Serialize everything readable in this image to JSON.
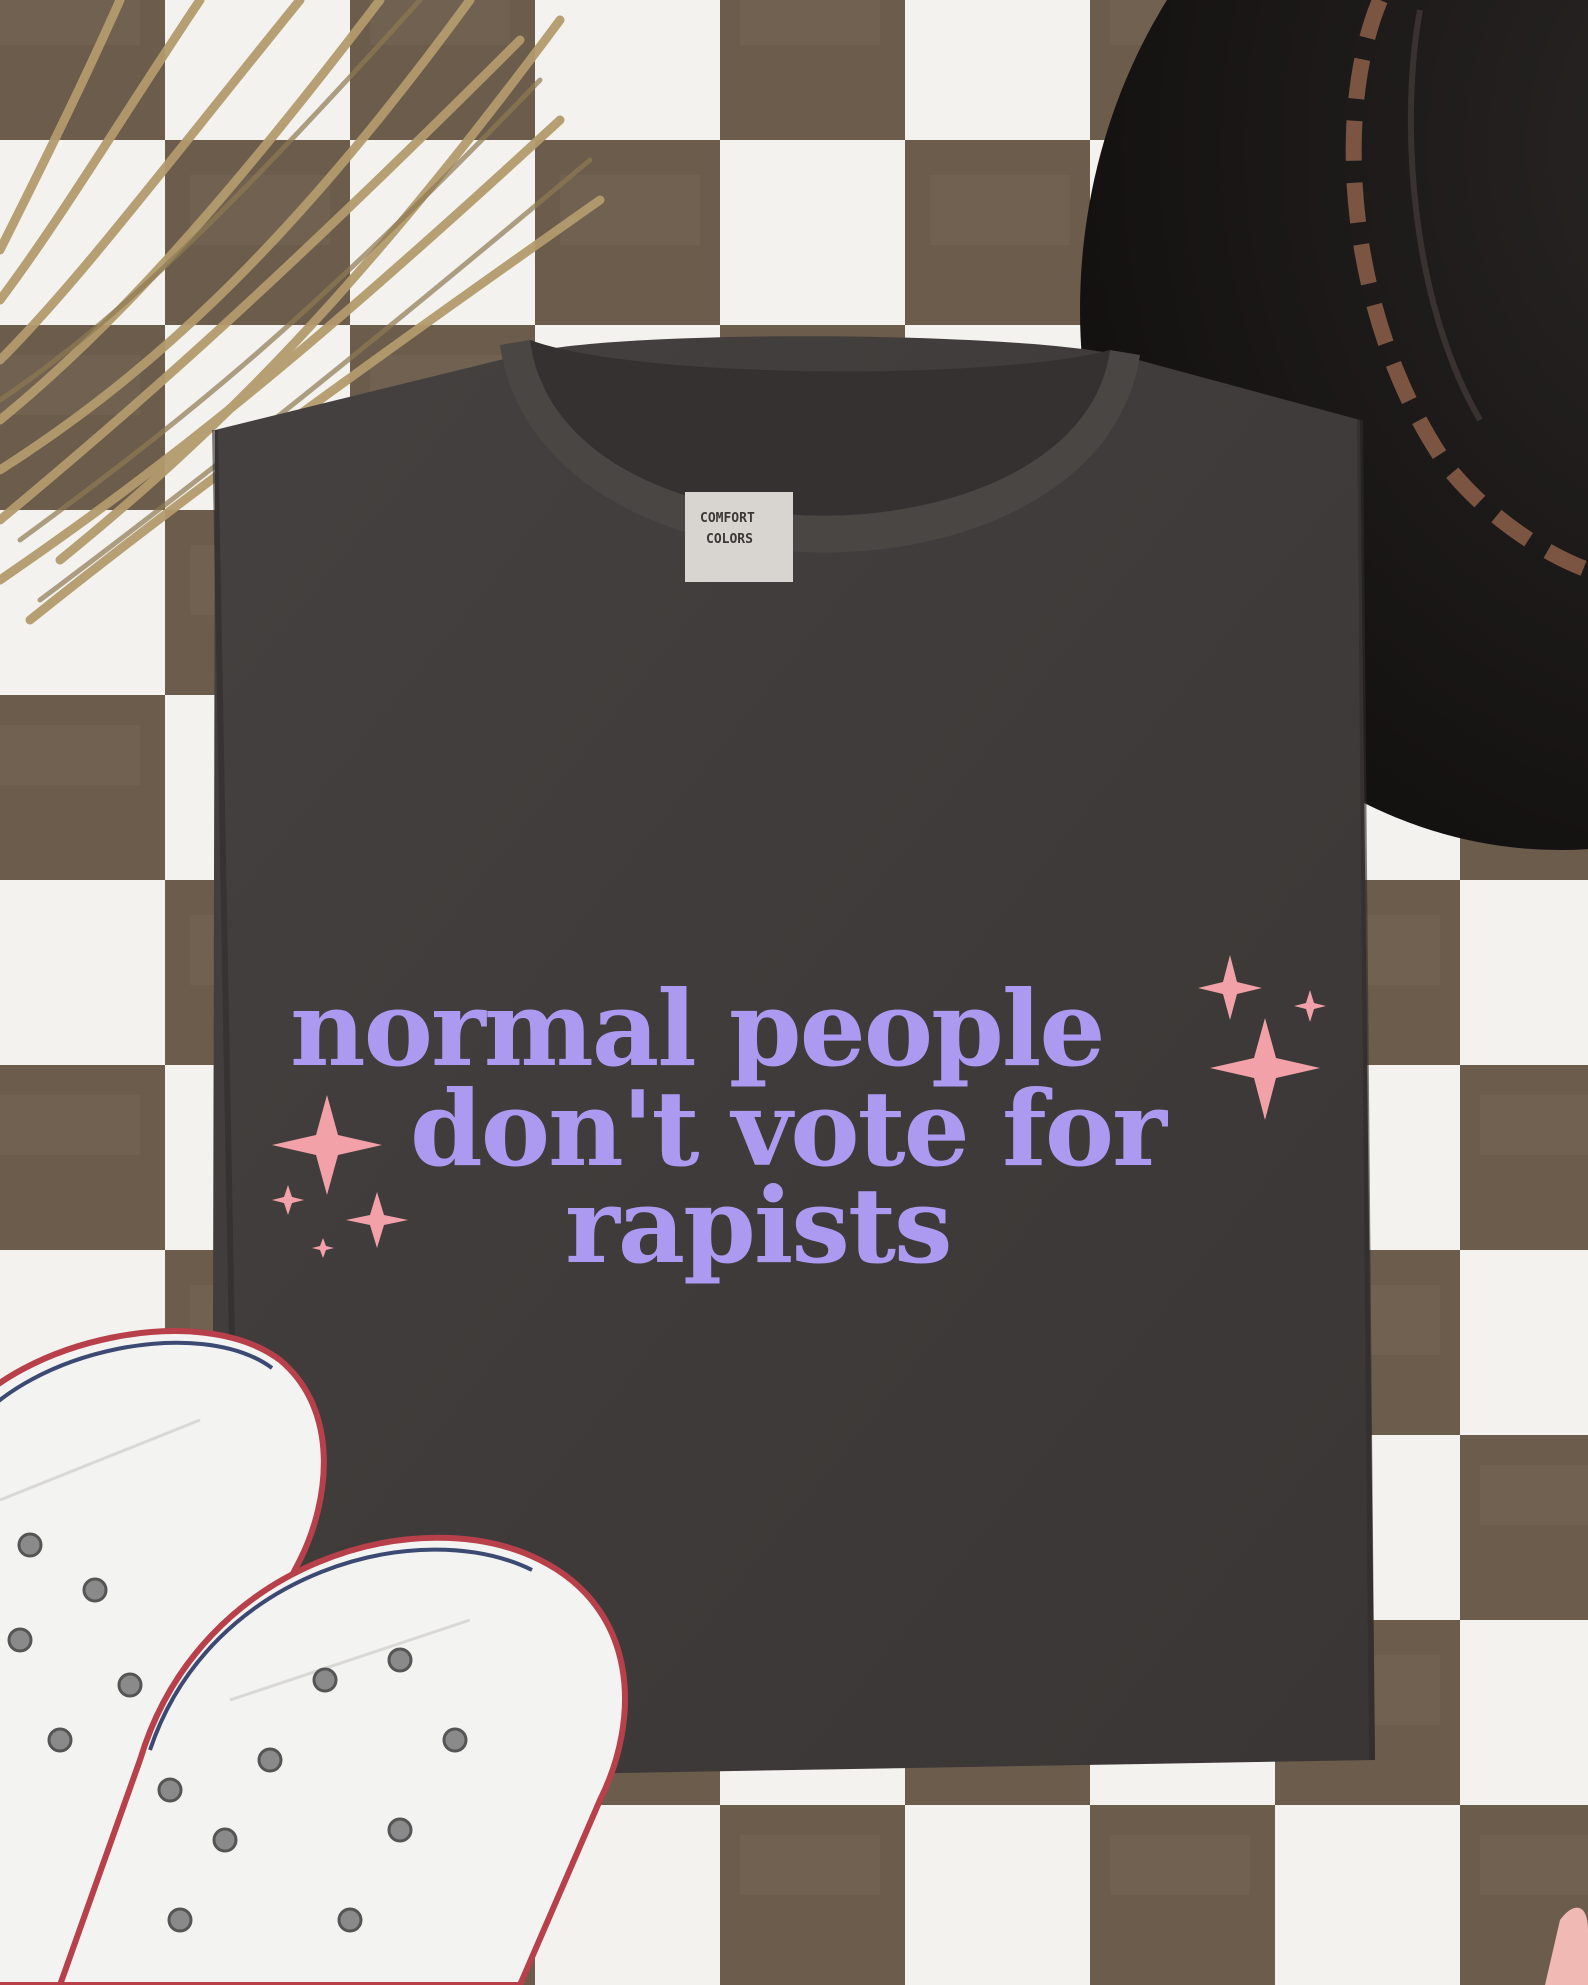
{
  "shirt": {
    "print_lines": [
      "normal people",
      "don't vote for",
      "rapists"
    ],
    "print_color": "#ab9af0",
    "sparkle_color": "#f2a1a8",
    "fabric_color": "#3f3b3a"
  },
  "neck_label": {
    "brand_line_1": "COMFORT",
    "brand_line_2": "COLORS"
  },
  "props": [
    "dried-pampas-grass",
    "black-felt-hat",
    "white-canvas-sneakers",
    "checkered-plush-rug"
  ],
  "colors": {
    "rug_dark": "#6b5c4c",
    "rug_light": "#f4f2ee",
    "hat": "#1b1917",
    "hat_band": "#7b5442",
    "grass": "#b39b6d",
    "sneaker": "#f3f3f1",
    "sneaker_stripe_red": "#b8404a",
    "sneaker_stripe_blue": "#3c4a73"
  }
}
